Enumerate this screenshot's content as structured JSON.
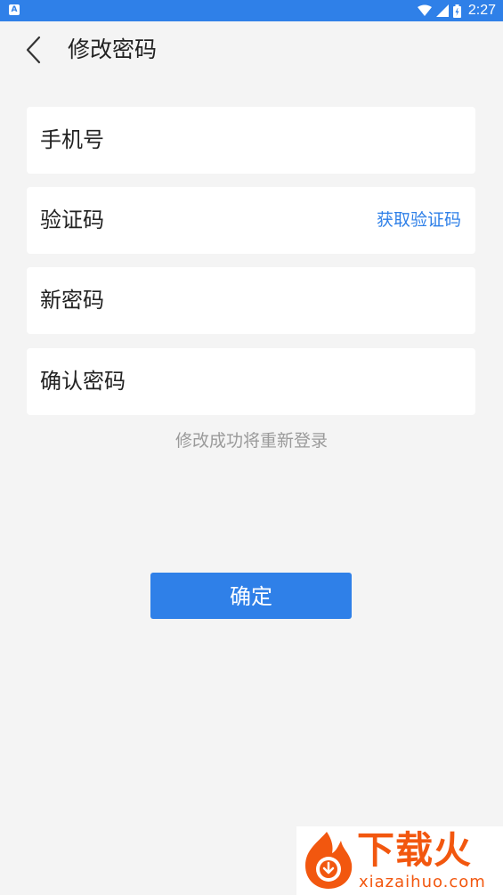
{
  "status_bar": {
    "left_icon": "A",
    "time": "2:27",
    "icons": [
      "wifi-icon",
      "signal-icon",
      "battery-icon"
    ]
  },
  "header": {
    "back_icon": "chevron-left-icon",
    "title": "修改密码"
  },
  "form": {
    "phone": {
      "label": "手机号",
      "value": ""
    },
    "code": {
      "label": "验证码",
      "value": "",
      "action": "获取验证码"
    },
    "new_password": {
      "label": "新密码",
      "value": ""
    },
    "confirm_password": {
      "label": "确认密码",
      "value": ""
    }
  },
  "hint": "修改成功将重新登录",
  "confirm_label": "确定",
  "watermark": {
    "title": "下载火",
    "subtitle": "xiazaihuo.com"
  },
  "colors": {
    "accent": "#2f80e8",
    "background": "#f4f4f4",
    "hint": "#9a9a9a",
    "watermark": "#f2570f"
  }
}
